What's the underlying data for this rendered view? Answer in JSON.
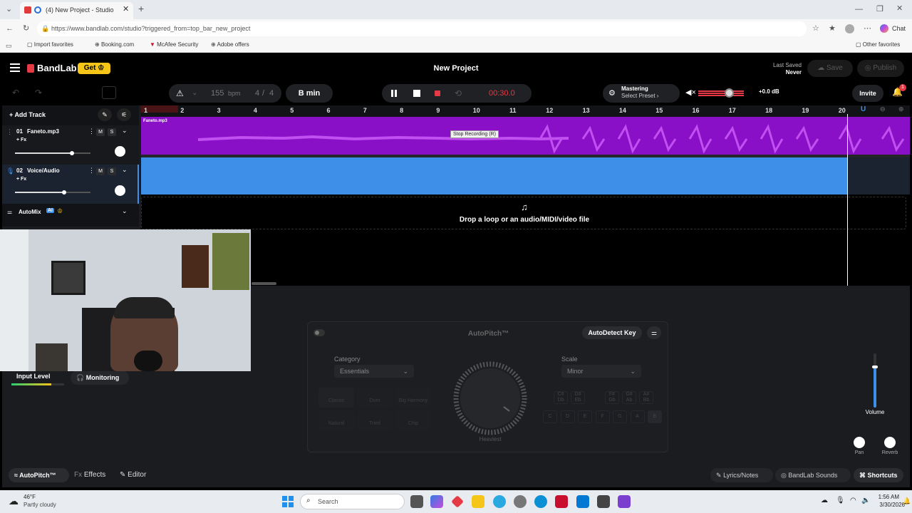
{
  "browser": {
    "tab_title": "(4) New Project - Studio",
    "url": "https://www.bandlab.com/studio?triggered_from=top_bar_new_project",
    "favorites": [
      "Import favorites",
      "Booking.com",
      "McAfee Security",
      "Adobe offers"
    ],
    "other_favorites": "Other favorites",
    "chat_label": "Chat"
  },
  "app": {
    "brand": "BandLab",
    "get_label": "Get",
    "project_title": "New Project",
    "last_saved_label": "Last Saved",
    "last_saved_value": "Never",
    "save_label": "Save",
    "publish_label": "Publish",
    "invite_label": "Invite",
    "notification_count": "1"
  },
  "toolbar": {
    "bpm_value": "155",
    "bpm_unit": "bpm",
    "time_sig_num": "4",
    "time_sig_sep": "/",
    "time_sig_den": "4",
    "key": "B min",
    "time": "00:30.0",
    "tooltip": "Stop Recording (R)",
    "mastering_label": "Mastering",
    "mastering_preset": "Select Preset",
    "db_value": "+0.0 dB"
  },
  "tracks_panel": {
    "add_track": "Add Track",
    "tracks": [
      {
        "number": "01",
        "name": "Faneto.mp3",
        "fx": "+ Fx",
        "m": "M",
        "s": "S",
        "volume": 0.75
      },
      {
        "number": "02",
        "name": "Voice/Audio",
        "fx": "+ Fx",
        "m": "M",
        "s": "S",
        "volume": 0.65
      }
    ],
    "automix_label": "AutoMix",
    "ai_badge": "AI"
  },
  "timeline": {
    "bars": [
      "1",
      "2",
      "3",
      "4",
      "5",
      "6",
      "7",
      "8",
      "9",
      "10",
      "11",
      "12",
      "13",
      "14",
      "15",
      "16",
      "17",
      "18",
      "19",
      "20"
    ],
    "clip_name": "Faneto.mp3",
    "drop_text": "Drop a loop or an audio/MIDI/video file"
  },
  "autopitch": {
    "title": "AutoPitch™",
    "autodetect_label": "AutoDetect Key",
    "category_label": "Category",
    "category_value": "Essentials",
    "scale_label": "Scale",
    "scale_value": "Minor",
    "knob_label": "Heaviest",
    "styles": [
      "Classic",
      "Duet",
      "Big Harmony",
      "Natural",
      "Tried",
      "Chip"
    ],
    "sharp_keys": [
      "C#\nDb",
      "D#\nEb",
      "F#\nGb",
      "G#\nAb",
      "A#\nBb"
    ],
    "natural_keys": [
      "C",
      "D",
      "E",
      "F",
      "G",
      "A",
      "B"
    ]
  },
  "input": {
    "input_level_label": "Input Level",
    "monitoring_label": "Monitoring"
  },
  "mixer": {
    "volume_label": "Volume",
    "pan_label": "Pan",
    "reverb_label": "Reverb",
    "volume_level": 0.75
  },
  "bottom_tabs": {
    "autopitch": "AutoPitch™",
    "effects": "Effects",
    "editor": "Editor",
    "lyrics": "Lyrics/Notes",
    "sounds": "BandLab Sounds",
    "shortcuts": "Shortcuts"
  },
  "taskbar": {
    "temperature": "46°F",
    "weather": "Partly cloudy",
    "search_placeholder": "Search",
    "time": "1:56 AM",
    "date": "3/30/2026"
  },
  "colors": {
    "accent_red": "#e63946",
    "purple_track": "#8a10c8",
    "blue_track": "#3d8fe8"
  }
}
